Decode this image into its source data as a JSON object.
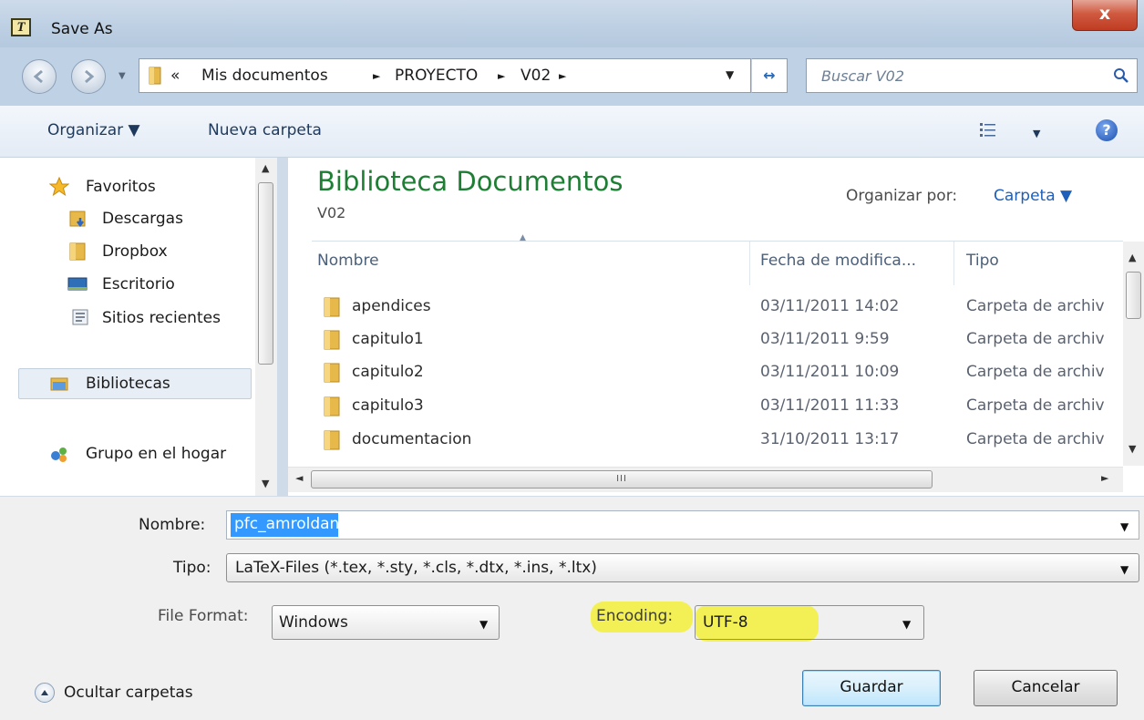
{
  "window": {
    "title": "Save As",
    "close_label": "x"
  },
  "address": {
    "overflow": "«",
    "crumbs": [
      "Mis documentos",
      "PROYECTO",
      "V02"
    ],
    "separator": "►",
    "search_placeholder": "Buscar V02"
  },
  "toolbar": {
    "organize_label": "Organizar ▼",
    "new_folder_label": "Nueva carpeta",
    "help_label": "?"
  },
  "nav": {
    "favorites": "Favoritos",
    "items": [
      "Descargas",
      "Dropbox",
      "Escritorio",
      "Sitios recientes"
    ],
    "libraries": "Bibliotecas",
    "homegroup": "Grupo en el hogar"
  },
  "main": {
    "library_title": "Biblioteca Documentos",
    "library_subtitle": "V02",
    "organize_by_label": "Organizar por:",
    "organize_by_value": "Carpeta ▼",
    "columns": [
      "Nombre",
      "Fecha de modifica...",
      "Tipo"
    ],
    "rows": [
      {
        "name": "apendices",
        "date": "03/11/2011 14:02",
        "type": "Carpeta de archiv"
      },
      {
        "name": "capitulo1",
        "date": "03/11/2011 9:59",
        "type": "Carpeta de archiv"
      },
      {
        "name": "capitulo2",
        "date": "03/11/2011 10:09",
        "type": "Carpeta de archiv"
      },
      {
        "name": "capitulo3",
        "date": "03/11/2011 11:33",
        "type": "Carpeta de archiv"
      },
      {
        "name": "documentacion",
        "date": "31/10/2011 13:17",
        "type": "Carpeta de archiv"
      }
    ],
    "hscroll_grip": "III"
  },
  "form": {
    "filename_label": "Nombre:",
    "filename_value": "pfc_amroldan",
    "type_label": "Tipo:",
    "type_value": "LaTeX-Files (*.tex, *.sty, *.cls, *.dtx, *.ins, *.ltx)",
    "format_label": "File Format:",
    "format_value": "Windows",
    "encoding_label": "Encoding:",
    "encoding_value": "UTF-8",
    "highlight_color": "#f3f03a"
  },
  "footer": {
    "hide_folders_label": "Ocultar carpetas",
    "save_label": "Guardar",
    "cancel_label": "Cancelar"
  }
}
